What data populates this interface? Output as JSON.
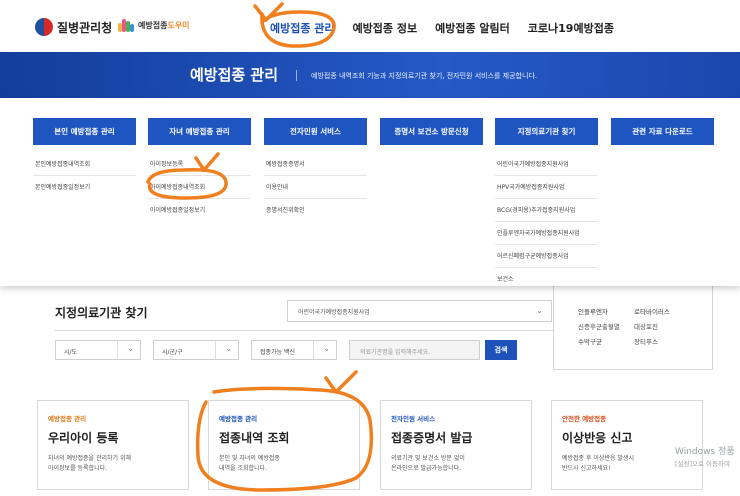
{
  "header": {
    "agency": "질병관리청",
    "helper_prefix": "예방접종",
    "helper_suffix": "도우미",
    "nav": [
      "예방접종 관리",
      "예방접종 정보",
      "예방접종 알림터",
      "코로나19예방접종"
    ]
  },
  "banner": {
    "title": "예방접종 관리",
    "description": "예방접종 내역조회 기능과 지정의료기관 찾기, 전자민원 서비스를 제공합니다."
  },
  "mega_menu": [
    {
      "title": "본인 예방접종 관리",
      "items": [
        "본인예방접종내역조회",
        "본인예방접종일정보기"
      ]
    },
    {
      "title": "자녀 예방접종 관리",
      "items": [
        "아이정보등록",
        "아이예방접종내역조회",
        "아이예방접종일정보기"
      ]
    },
    {
      "title": "전자민원 서비스",
      "items": [
        "예방접종증명서",
        "이용안내",
        "증명서진위확인"
      ]
    },
    {
      "title": "증명서 보건소 방문신청",
      "items": []
    },
    {
      "title": "지정의료기관 찾기",
      "items": [
        "어린이국가예방접종지원사업",
        "HPV국가예방접종지원사업",
        "BCG(경피용)추가접종지원사업",
        "인플루엔자국가예방접종지원사업",
        "어르신폐렴구균예방접종사업",
        "보건소"
      ]
    },
    {
      "title": "관련 자료 다운로드",
      "items": []
    }
  ],
  "search": {
    "title": "지정의료기관 찾기",
    "program_select": "어린이국가예방접종지원사업",
    "selects": [
      "시/도",
      "시/군/구",
      "접종가능 백신"
    ],
    "input_placeholder": "의료기관명을 입력해주세요.",
    "button": "검색"
  },
  "side_box": {
    "items": [
      "인플루엔자",
      "로타바이러스",
      "신증후군출혈열",
      "대상포진",
      "수막구균",
      "장티푸스"
    ]
  },
  "cards": [
    {
      "category": "예방접종 관리",
      "title": "우리아이 등록",
      "desc1": "자녀의 예방접종을 관리하기 위해",
      "desc2": "아이정보를 등록합니다.",
      "color": "#e07b1a"
    },
    {
      "category": "예방접종 관리",
      "title": "접종내역 조회",
      "desc1": "본인 및 자녀의 예방접종",
      "desc2": "내역을 조회합니다.",
      "color": "#1d52bb"
    },
    {
      "category": "전자민원 서비스",
      "title": "접종증명서 발급",
      "desc1": "의료기관 및 보건소 방문 없이",
      "desc2": "온라인으로 발급가능합니다.",
      "color": "#1d52bb"
    },
    {
      "category": "안전한 예방접종",
      "title": "이상반응 신고",
      "desc1": "예방접종 후 이상반응 발생시",
      "desc2": "반드시 신고하세요!",
      "color": "#d84f1f"
    }
  ],
  "watermark": {
    "line1": "Windows 정품",
    "line2": "[설정]으로 이동하여"
  },
  "colors": {
    "primary": "#1f55c0",
    "annotation": "#f07f1f",
    "banner": "#1a47ad"
  }
}
